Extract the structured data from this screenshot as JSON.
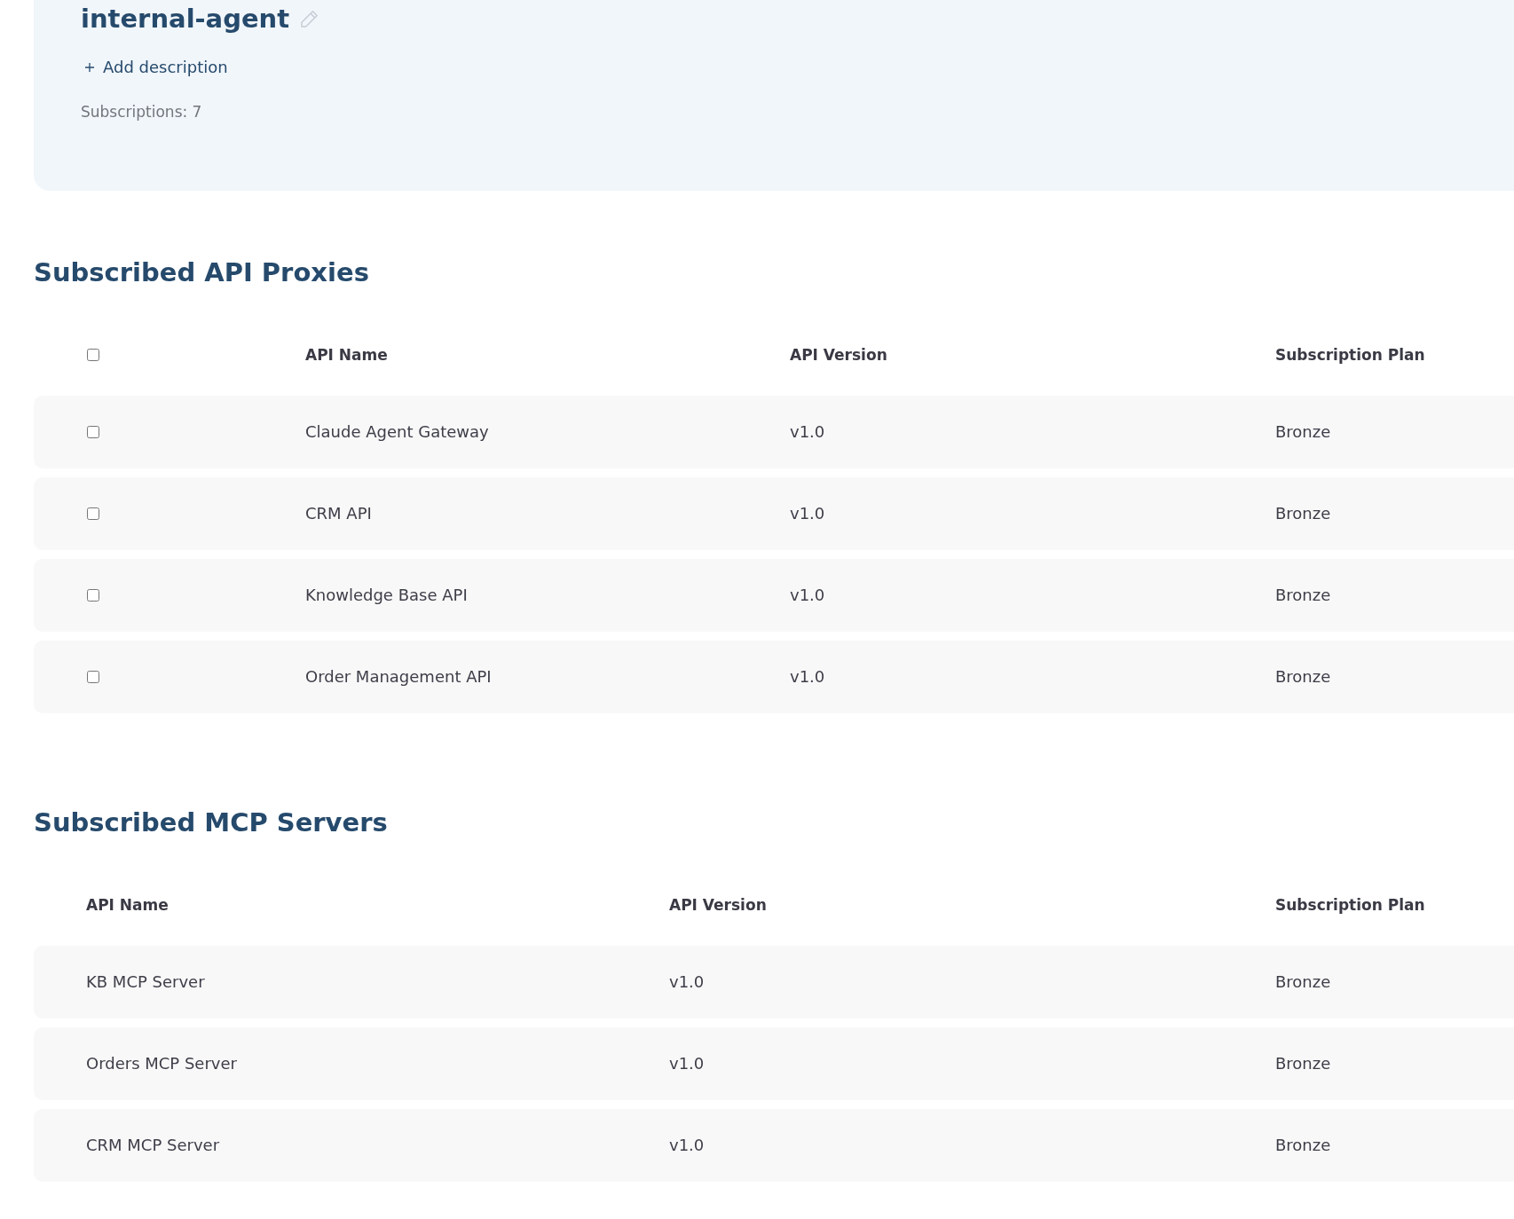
{
  "agent": {
    "name": "internal-agent",
    "add_description": "Add description",
    "subscriptions": "Subscriptions: 7"
  },
  "sections": [
    {
      "kind": "selectable",
      "title": "Subscribed API Proxies",
      "select_all": {
        "checked": false
      },
      "columns": [
        "API Name",
        "API Version",
        "Subscription Plan"
      ],
      "rows": [
        {
          "checked": false,
          "cells": [
            "Claude Agent Gateway",
            "v1.0",
            "Bronze"
          ]
        },
        {
          "checked": false,
          "cells": [
            "CRM API",
            "v1.0",
            "Bronze"
          ]
        },
        {
          "checked": false,
          "cells": [
            "Knowledge Base API",
            "v1.0",
            "Bronze"
          ]
        },
        {
          "checked": false,
          "cells": [
            "Order Management API",
            "v1.0",
            "Bronze"
          ]
        }
      ]
    },
    {
      "kind": "plain",
      "title": "Subscribed MCP Servers",
      "columns": [
        "API Name",
        "API Version",
        "Subscription Plan"
      ],
      "rows": [
        {
          "cells": [
            "KB MCP Server",
            "v1.0",
            "Bronze"
          ]
        },
        {
          "cells": [
            "Orders MCP Server",
            "v1.0",
            "Bronze"
          ]
        },
        {
          "cells": [
            "CRM MCP Server",
            "v1.0",
            "Bronze"
          ]
        }
      ]
    }
  ]
}
